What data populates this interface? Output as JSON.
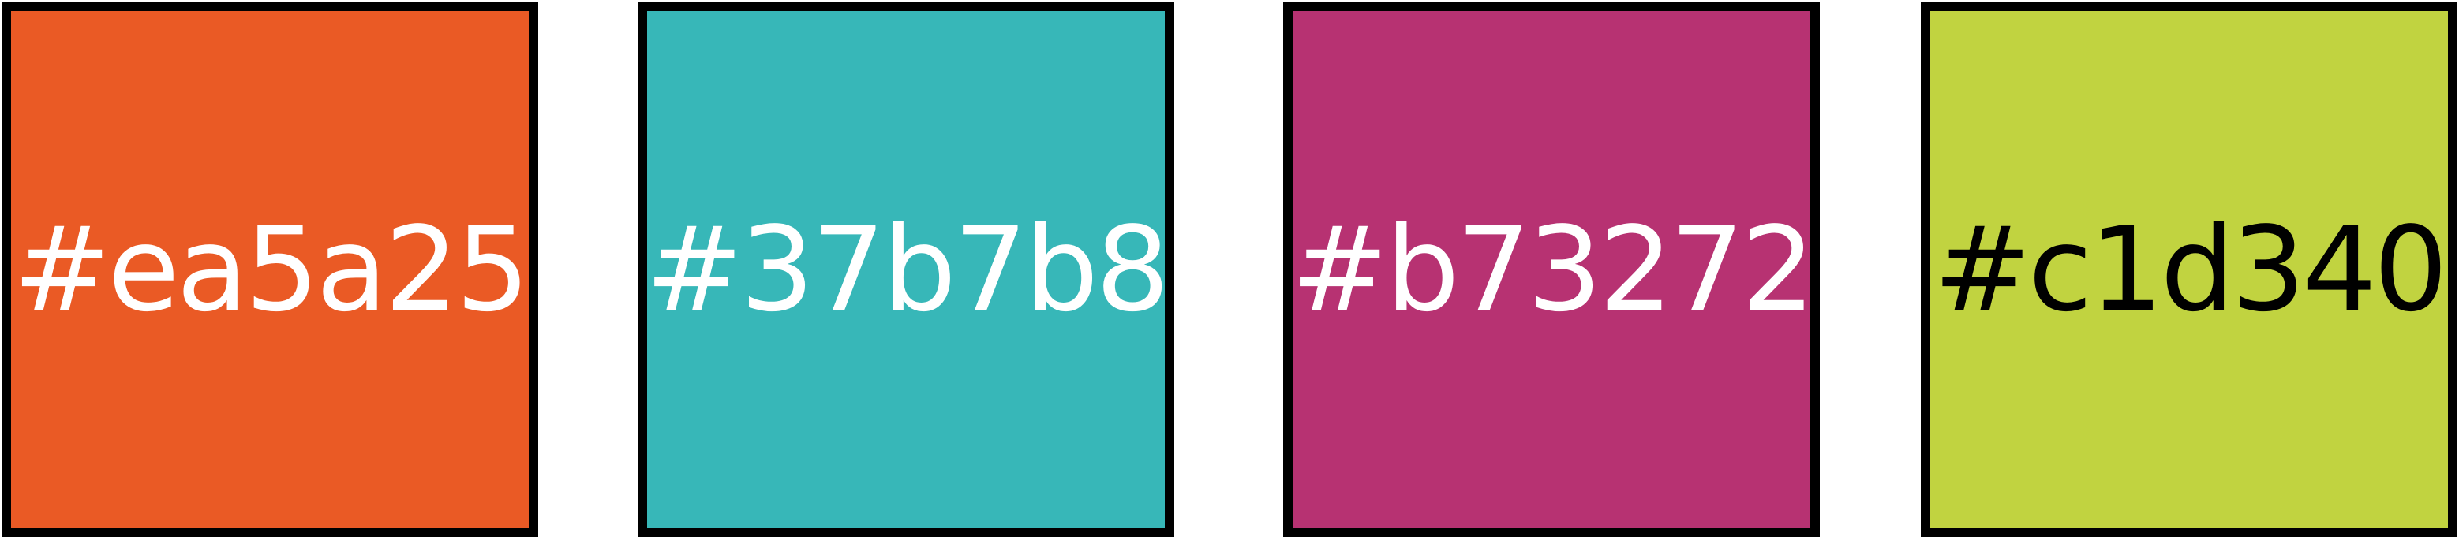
{
  "swatches": [
    {
      "label": "#ea5a25",
      "color": "#ea5a25",
      "text_color": "#ffffff"
    },
    {
      "label": "#37b7b8",
      "color": "#37b7b8",
      "text_color": "#ffffff"
    },
    {
      "label": "#b73272",
      "color": "#b73272",
      "text_color": "#ffffff"
    },
    {
      "label": "#c1d340",
      "color": "#c1d340",
      "text_color": "#000000"
    }
  ]
}
